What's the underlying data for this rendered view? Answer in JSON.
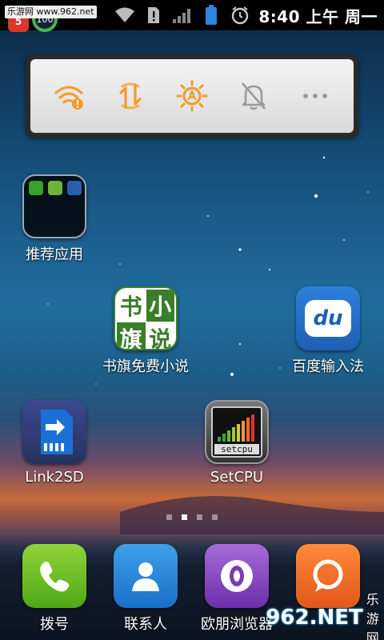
{
  "status_bar": {
    "watermark": "乐游网 www.962.net",
    "notification_count": "5",
    "ring_value": "100",
    "time": "8:40 上午 周一",
    "icons": [
      "wifi-icon",
      "sim-alert-icon",
      "signal-icon",
      "battery-icon",
      "alarm-icon"
    ]
  },
  "quick_toggles": {
    "items": [
      "wifi-toggle-icon",
      "sync-toggle-icon",
      "brightness-auto-icon",
      "silent-bell-icon",
      "more-icon"
    ],
    "accent_color": "#f39a2a",
    "inactive_color": "#9a9a9a"
  },
  "apps": {
    "folder": {
      "label": "推荐应用"
    },
    "shuqi": {
      "label": "书旗免费小说",
      "glyphs": [
        "书",
        "小",
        "旗",
        "说"
      ]
    },
    "baidu": {
      "label": "百度输入法",
      "glyph": "du"
    },
    "link2sd": {
      "label": "Link2SD"
    },
    "setcpu": {
      "label": "SetCPU",
      "glyph": "setcpu"
    }
  },
  "page_indicator": {
    "count": 4,
    "active_index": 1
  },
  "dock": {
    "phone": {
      "label": "拨号"
    },
    "contacts": {
      "label": "联系人"
    },
    "browser": {
      "label": "欧朋浏览器"
    },
    "chat": {
      "label": ""
    }
  },
  "watermark_bottom": {
    "big": "962.NET",
    "small": "乐游网"
  }
}
